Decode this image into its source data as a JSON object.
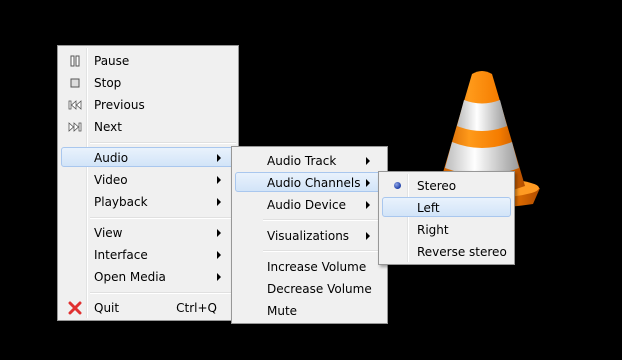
{
  "main_menu": {
    "items": [
      {
        "label": "Pause",
        "icon": "pause-icon"
      },
      {
        "label": "Stop",
        "icon": "stop-icon"
      },
      {
        "label": "Previous",
        "icon": "previous-icon"
      },
      {
        "label": "Next",
        "icon": "next-icon"
      },
      {
        "label": "Audio",
        "submenu": true,
        "highlighted": true
      },
      {
        "label": "Video",
        "submenu": true
      },
      {
        "label": "Playback",
        "submenu": true
      },
      {
        "label": "View",
        "submenu": true
      },
      {
        "label": "Interface",
        "submenu": true
      },
      {
        "label": "Open Media",
        "submenu": true
      },
      {
        "label": "Quit",
        "icon": "quit-icon",
        "shortcut": "Ctrl+Q"
      }
    ]
  },
  "audio_menu": {
    "items": [
      {
        "label": "Audio Track",
        "submenu": true
      },
      {
        "label": "Audio Channels",
        "submenu": true,
        "highlighted": true
      },
      {
        "label": "Audio Device",
        "submenu": true
      },
      {
        "label": "Visualizations",
        "submenu": true
      },
      {
        "label": "Increase Volume"
      },
      {
        "label": "Decrease Volume"
      },
      {
        "label": "Mute"
      }
    ]
  },
  "channels_menu": {
    "items": [
      {
        "label": "Stereo",
        "selected": true
      },
      {
        "label": "Left",
        "highlighted": true
      },
      {
        "label": "Right"
      },
      {
        "label": "Reverse stereo"
      }
    ]
  },
  "colors": {
    "background": "#000000",
    "menu_bg": "#f0f0f0",
    "highlight_border": "#a9c7ee",
    "cone_orange": "#f7850a",
    "quit_icon_red": "#e03030"
  }
}
